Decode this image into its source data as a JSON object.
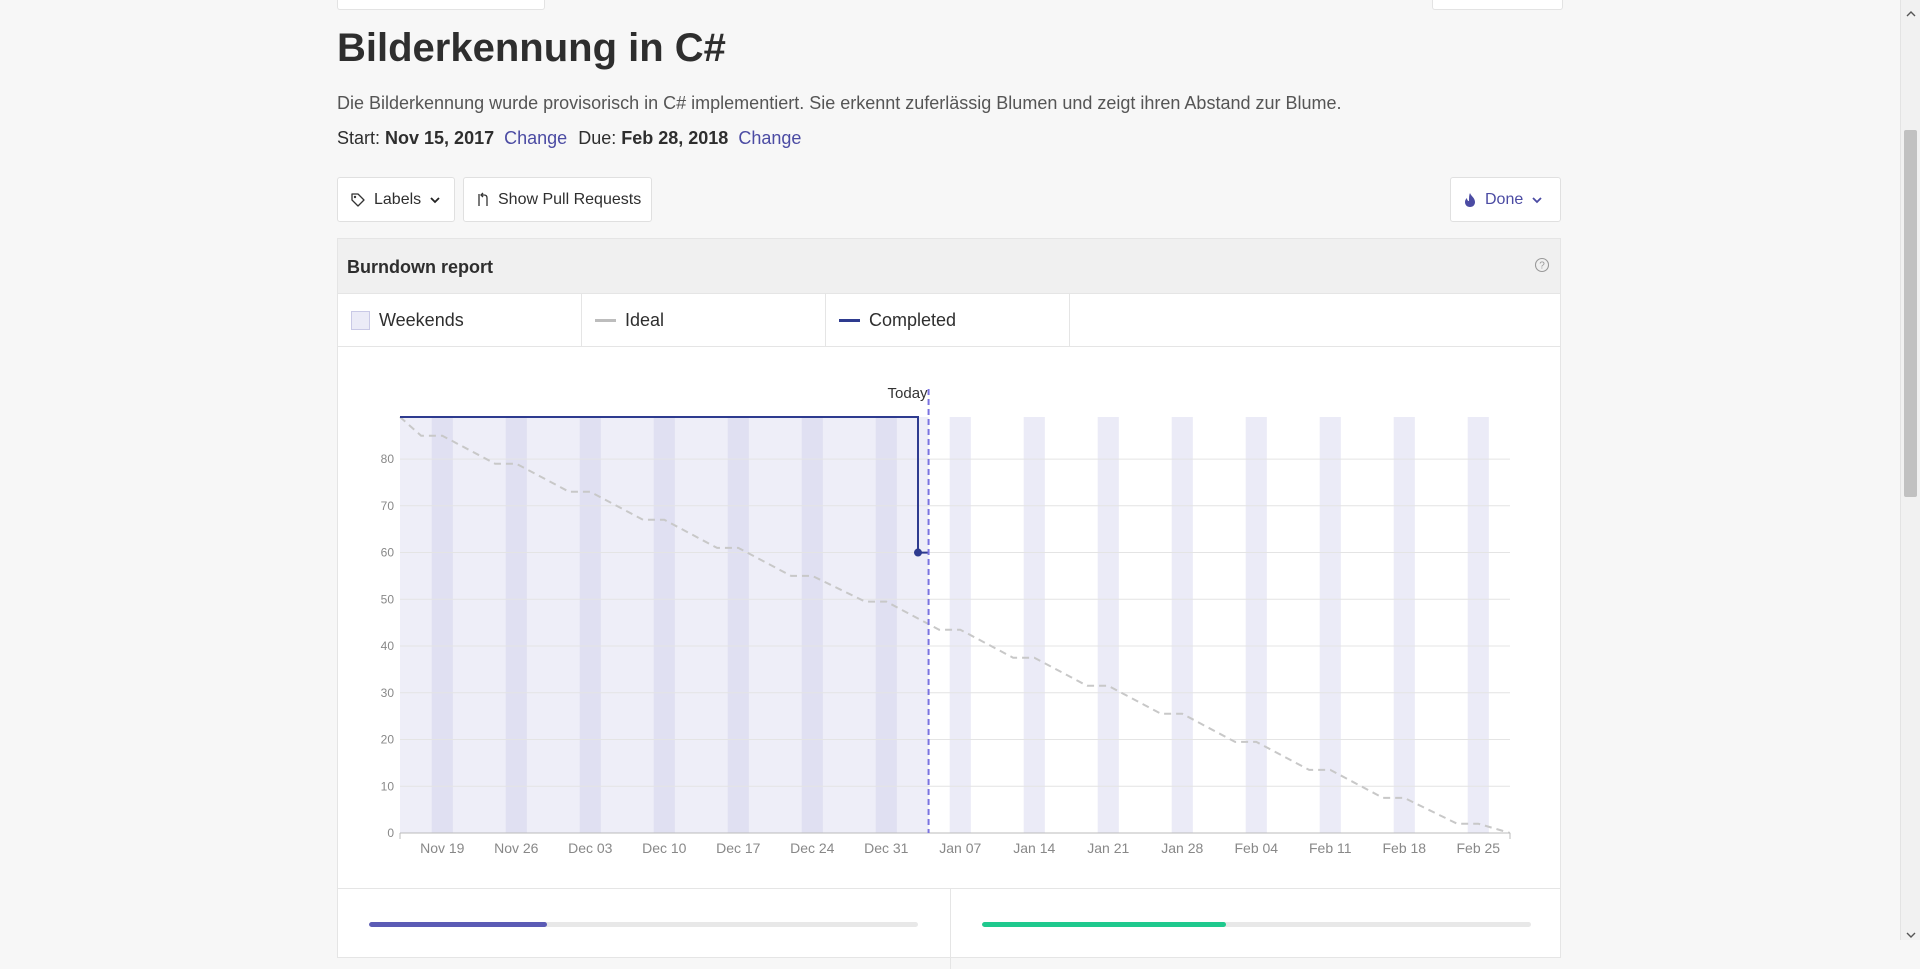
{
  "milestone": {
    "title": "Bilderkennung in C#",
    "description": "Die Bilderkennung wurde provisorisch in C# implementiert. Sie erkennt zuferlässig Blumen und zeigt ihren Abstand zur Blume.",
    "start_label": "Start:",
    "start_date": "Nov 15, 2017",
    "due_label": "Due:",
    "due_date": "Feb 28, 2018",
    "change_label": "Change"
  },
  "toolbar": {
    "labels_button": "Labels",
    "pull_requests_button": "Show Pull Requests",
    "status_button": "Done"
  },
  "burndown": {
    "title": "Burndown report",
    "legend": {
      "weekends": "Weekends",
      "ideal": "Ideal",
      "completed": "Completed"
    },
    "today_label": "Today"
  },
  "progress": {
    "left": {
      "fraction": 0.325,
      "color": "#5b5bb5"
    },
    "right": {
      "fraction": 0.445,
      "color": "#1fc98e"
    }
  },
  "colors": {
    "accent": "#4b4ba3",
    "completed_line": "#2e3b8f",
    "ideal_line": "#c8c8c8",
    "weekend_band": "#ebebf7",
    "past_shade": "#eeeef8",
    "today_line": "#7a73e0"
  },
  "chart_data": {
    "type": "line",
    "title": "",
    "xlabel": "",
    "ylabel": "",
    "ylim": [
      0,
      89
    ],
    "x_range": [
      "2017-11-15",
      "2018-02-28"
    ],
    "yticks": [
      0,
      10,
      20,
      30,
      40,
      50,
      60,
      70,
      80
    ],
    "xticks": [
      "Nov 19",
      "Nov 26",
      "Dec 03",
      "Dec 10",
      "Dec 17",
      "Dec 24",
      "Dec 31",
      "Jan 07",
      "Jan 14",
      "Jan 21",
      "Jan 28",
      "Feb 04",
      "Feb 11",
      "Feb 18",
      "Feb 25"
    ],
    "today": "2018-01-04",
    "weekends": [
      "2017-11-18",
      "2017-11-25",
      "2017-12-02",
      "2017-12-09",
      "2017-12-16",
      "2017-12-23",
      "2017-12-30",
      "2018-01-06",
      "2018-01-13",
      "2018-01-20",
      "2018-01-27",
      "2018-02-03",
      "2018-02-10",
      "2018-02-17",
      "2018-02-24"
    ],
    "series": [
      {
        "name": "Ideal",
        "style": "dashed",
        "points": [
          [
            "2017-11-15",
            89
          ],
          [
            "2017-11-17",
            85
          ],
          [
            "2017-11-19",
            85
          ],
          [
            "2017-11-24",
            79
          ],
          [
            "2017-11-26",
            79
          ],
          [
            "2017-12-01",
            73
          ],
          [
            "2017-12-03",
            73
          ],
          [
            "2017-12-08",
            67
          ],
          [
            "2017-12-10",
            67
          ],
          [
            "2017-12-15",
            61
          ],
          [
            "2017-12-17",
            61
          ],
          [
            "2017-12-22",
            55
          ],
          [
            "2017-12-24",
            55
          ],
          [
            "2017-12-29",
            49.5
          ],
          [
            "2017-12-31",
            49.5
          ],
          [
            "2018-01-05",
            43.5
          ],
          [
            "2018-01-07",
            43.5
          ],
          [
            "2018-01-12",
            37.5
          ],
          [
            "2018-01-14",
            37.5
          ],
          [
            "2018-01-19",
            31.5
          ],
          [
            "2018-01-21",
            31.5
          ],
          [
            "2018-01-26",
            25.5
          ],
          [
            "2018-01-28",
            25.5
          ],
          [
            "2018-02-02",
            19.5
          ],
          [
            "2018-02-04",
            19.5
          ],
          [
            "2018-02-09",
            13.5
          ],
          [
            "2018-02-11",
            13.5
          ],
          [
            "2018-02-16",
            7.5
          ],
          [
            "2018-02-18",
            7.5
          ],
          [
            "2018-02-23",
            2
          ],
          [
            "2018-02-25",
            2
          ],
          [
            "2018-02-28",
            0
          ]
        ]
      },
      {
        "name": "Completed",
        "style": "solid",
        "points": [
          [
            "2017-11-15",
            89
          ],
          [
            "2018-01-03",
            89
          ],
          [
            "2018-01-03",
            60
          ],
          [
            "2018-01-04",
            60
          ]
        ]
      }
    ]
  }
}
